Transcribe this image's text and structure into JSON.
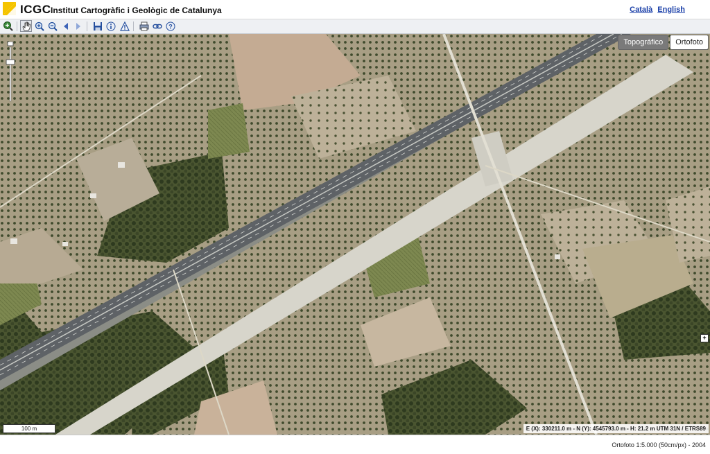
{
  "header": {
    "logo": "ICGC",
    "org_name": "Institut Cartogràfic i Geològic de Catalunya",
    "languages": [
      "Català",
      "English"
    ]
  },
  "toolbar": {
    "tools": [
      "zoom-extent-icon",
      "hand-pan-icon",
      "zoom-in-icon",
      "zoom-out-icon",
      "back-arrow-icon",
      "forward-arrow-icon",
      "save-icon",
      "info-icon",
      "warning-icon",
      "print-icon",
      "link-icon",
      "help-icon"
    ]
  },
  "map": {
    "layer_buttons": [
      "Topográfico",
      "Ortofoto"
    ],
    "active_layer": "Ortofoto",
    "scale_label": "100 m",
    "coords": "E (X): 330211.0 m - N (Y): 4545793.0 m - H: 21.2 m",
    "crs": "UTM 31N / ETRS89"
  },
  "status": {
    "text": "Ortofoto 1:5.000 (50cm/px) - 2004"
  },
  "colors": {
    "link": "#1a3fa8",
    "logo_yellow": "#f5c400",
    "toolbar_bg": "#eef0f3"
  }
}
